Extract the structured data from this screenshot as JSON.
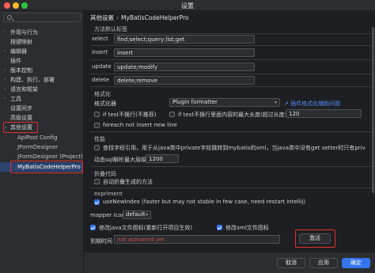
{
  "window": {
    "title": "设置"
  },
  "sidebar": {
    "items": [
      {
        "label": "外观与行为",
        "chevron": "›"
      },
      {
        "label": "按键映射",
        "chevron": ""
      },
      {
        "label": "编辑器",
        "chevron": "›"
      },
      {
        "label": "插件",
        "chevron": ""
      },
      {
        "label": "版本控制",
        "chevron": "›"
      },
      {
        "label": "构建、执行、部署",
        "chevron": "›"
      },
      {
        "label": "语言和框架",
        "chevron": "›"
      },
      {
        "label": "工具",
        "chevron": "›"
      },
      {
        "label": "高级设置",
        "chevron": ""
      },
      {
        "label": "其他设置",
        "chevron": "⌄"
      },
      {
        "label": "ApiPost Config",
        "chevron": ""
      },
      {
        "label": "JFormDesigner",
        "chevron": ""
      },
      {
        "label": "JFormDesigner (Project)",
        "chevron": ""
      },
      {
        "label": "MyBatisCodeHelperPro",
        "chevron": ""
      }
    ],
    "item_syncing": "设置同步"
  },
  "breadcrumb": {
    "parent": "其他设置",
    "separator": "›",
    "current": "MyBatisCodeHelperPro"
  },
  "methods": {
    "section": "方法默认标签",
    "rows": [
      {
        "label": "select",
        "value": "find;select;query;list;get"
      },
      {
        "label": "insert",
        "value": "insert"
      },
      {
        "label": "update",
        "value": "update;modify"
      },
      {
        "label": "delete",
        "value": "delete;remove"
      }
    ]
  },
  "format": {
    "section": "格式化",
    "formatter_label": "格式化器",
    "formatter_value": "Plugin formatter",
    "formatter_link": "插件格式化辅助问题",
    "if_test_nowrap": "if test不换行(不推荐)",
    "if_test_maxlen_label": "if test不换行里面内容的最大长度(超过长度会换行)",
    "if_test_maxlen_value": "120",
    "foreach_nowrap": "foreach not insert new line"
  },
  "performance": {
    "section": "性能",
    "find_fields": "查找字段引用，用于从java类中private字段跳转到mybatis的xml，当java类中没有get setter时只有private字段需要从xml字段",
    "dynamic_sql_label": "动态sql解析最大层级",
    "dynamic_sql_value": "1200"
  },
  "fold": {
    "section": "折叠代码",
    "auto_fold": "自动折叠生成的方法"
  },
  "experiment": {
    "section": "expriment",
    "use_new_index": "useNewIndex (faster but may not stable in few case, need restart intellij)"
  },
  "mapper_icon": {
    "label": "mapper icon",
    "value": "default"
  },
  "options": {
    "modify_java_icon": "修改java文件图标(重新打开项目生效)",
    "modify_xml_icon": "修改xml文件图标"
  },
  "expiry": {
    "label": "到期时间",
    "placeholder": "not activated yet",
    "activate_button": "激活"
  },
  "footer": {
    "cancel": "取消",
    "apply": "应用",
    "ok": "确定"
  },
  "colors": {
    "accent": "#3574f0",
    "highlight_box": "#e0322f",
    "link": "#548af7"
  }
}
